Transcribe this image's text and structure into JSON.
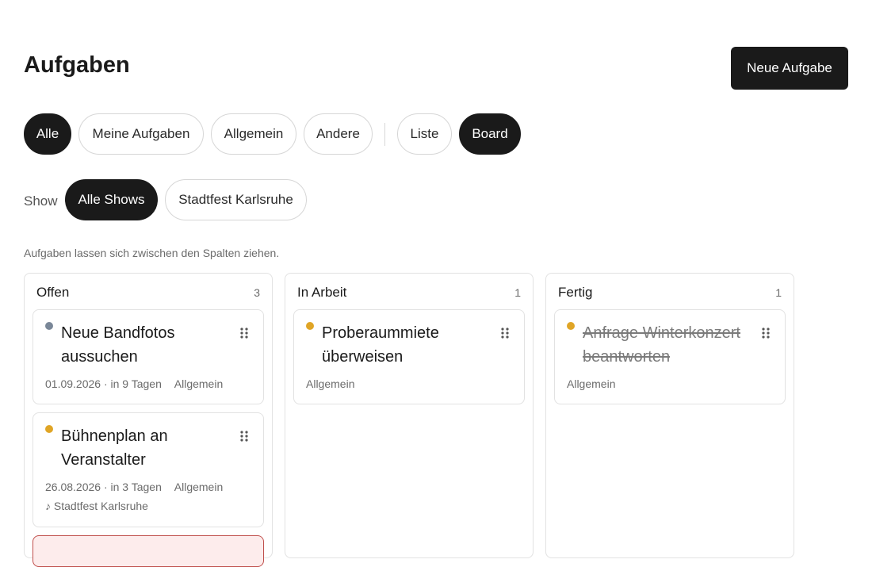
{
  "header": {
    "title": "Aufgaben",
    "new_task_label": "Neue Aufgabe"
  },
  "filters": {
    "scope": [
      {
        "label": "Alle",
        "active": true
      },
      {
        "label": "Meine Aufgaben",
        "active": false
      },
      {
        "label": "Allgemein",
        "active": false
      },
      {
        "label": "Andere",
        "active": false
      }
    ],
    "view": [
      {
        "label": "Liste",
        "active": false
      },
      {
        "label": "Board",
        "active": true
      }
    ]
  },
  "show_filter": {
    "label": "Show",
    "options": [
      {
        "label": "Alle Shows",
        "active": true
      },
      {
        "label": "Stadtfest Karlsruhe",
        "active": false
      }
    ]
  },
  "hint": "Aufgaben lassen sich zwischen den Spalten ziehen.",
  "colors": {
    "accent": "#1a1a1a",
    "priority_low": "#7a8798",
    "priority_medium": "#e0a526",
    "alert_border": "#c0504d",
    "alert_bg": "#fdecec"
  },
  "board": {
    "columns": [
      {
        "title": "Offen",
        "count": "3",
        "cards": [
          {
            "title": "Neue Bandfotos aussuchen",
            "date": "01.09.2026",
            "due": "· in 9 Tagen",
            "category": "Allgemein",
            "show": ""
          },
          {
            "title": "Bühnenplan an Veranstalter",
            "date": "26.08.2026",
            "due": "· in 3 Tagen",
            "category": "Allgemein",
            "show": "♪ Stadtfest Karlsruhe"
          }
        ]
      },
      {
        "title": "In Arbeit",
        "count": "1",
        "cards": [
          {
            "title": "Proberaummiete überweisen",
            "category": "Allgemein"
          }
        ]
      },
      {
        "title": "Fertig",
        "count": "1",
        "cards": [
          {
            "title": "Anfrage Winterkonzert beantworten",
            "category": "Allgemein"
          }
        ]
      }
    ]
  }
}
